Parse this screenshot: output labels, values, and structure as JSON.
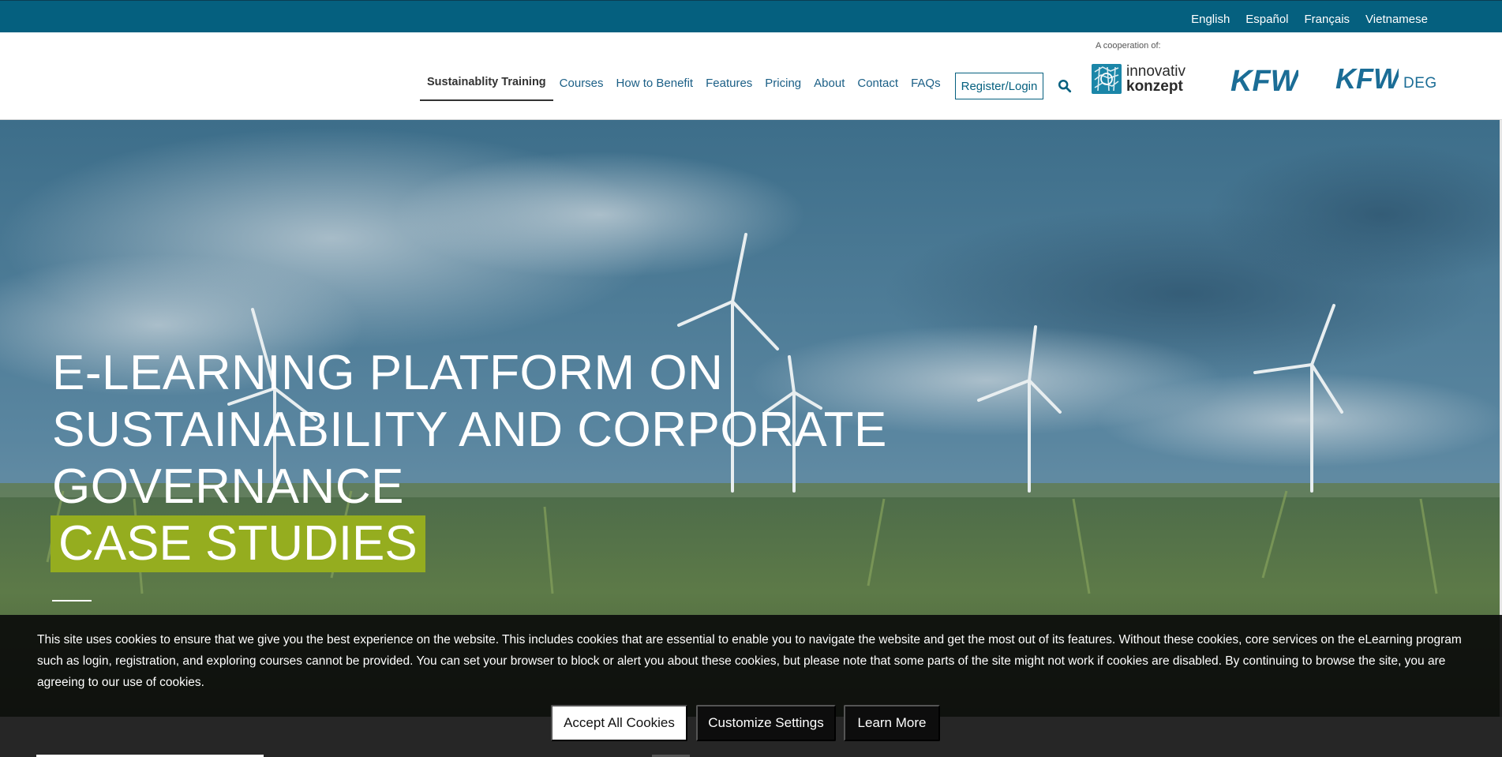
{
  "languages": [
    "English",
    "Español",
    "Français",
    "Vietnamese"
  ],
  "nav": {
    "items": [
      "Sustainablity Training",
      "Courses",
      "How to Benefit",
      "Features",
      "Pricing",
      "About",
      "Contact",
      "FAQs"
    ],
    "register_label": "Register/Login",
    "search_icon": "search-icon"
  },
  "partners": {
    "cooperation_label": "A cooperation of:",
    "innovativ_line1": "innovativ",
    "innovativ_line2": "konzept",
    "kfw": "KFW",
    "kfw_deg": "KFW",
    "deg": "DEG"
  },
  "hero": {
    "title_lines": [
      "E-LEARNING PLATFORM ON",
      "SUSTAINABILITY AND CORPORATE",
      "GOVERNANCE"
    ],
    "highlight": "CASE STUDIES"
  },
  "cookie": {
    "text": "This site uses cookies to ensure that we give you the best experience on the website. This includes cookies that are essential to enable you to navigate the website and get the most out of its features. Without these cookies, core services on the eLearning program such as login, registration, and exploring courses cannot be provided. You can set your browser to block or alert you about these cookies, but please note that some parts of the site might not work if cookies are disabled. By continuing to browse the site, you are agreeing to our use of cookies.",
    "accept_label": "Accept All Cookies",
    "customize_label": "Customize Settings",
    "learn_label": "Learn More"
  },
  "colors": {
    "topbar": "#05607f",
    "nav_link": "#1b5f86",
    "highlight": "#95ad1f",
    "cookie_bg": "#0a0a0a"
  }
}
